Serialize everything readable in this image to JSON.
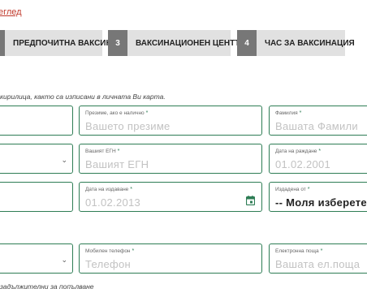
{
  "header": {
    "back_link": "еглед"
  },
  "steps": [
    {
      "num": "",
      "label": "ПРЕДПОЧИТНА ВАКСИНА"
    },
    {
      "num": "3",
      "label": "ВАКСИНАЦИОНЕН ЦЕНТЪР"
    },
    {
      "num": "4",
      "label": "ЧАС ЗА ВАКСИНАЦИЯ"
    }
  ],
  "note": "кирилица, както са изписани в личната Ви карта.",
  "fields": {
    "middle_name": {
      "label": "Презиме, ако е налично",
      "placeholder": "Вашето презиме"
    },
    "last_name": {
      "label": "Фамилия",
      "placeholder": "Вашата Фамили"
    },
    "egn": {
      "label": "Вашият ЕГН",
      "placeholder": "Вашият ЕГН"
    },
    "birth_date": {
      "label": "Дата на раждане",
      "placeholder": "01.02.2001"
    },
    "issue_date": {
      "label": "Дата на издаване",
      "placeholder": "01.02.2013"
    },
    "issued_by": {
      "label": "Издадена от",
      "value": "-- Моля изберете"
    },
    "mobile": {
      "label": "Мобилен телефон",
      "placeholder": "Телефон"
    },
    "email": {
      "label": "Електронна поща",
      "placeholder": "Вашата ел.поща"
    }
  },
  "required_mark": "*",
  "footnote": "задължителни за попълване",
  "colors": {
    "accent": "#2e7d55",
    "link": "#c0392b",
    "step_bg": "#e1e1e1",
    "step_num_bg": "#777777"
  }
}
